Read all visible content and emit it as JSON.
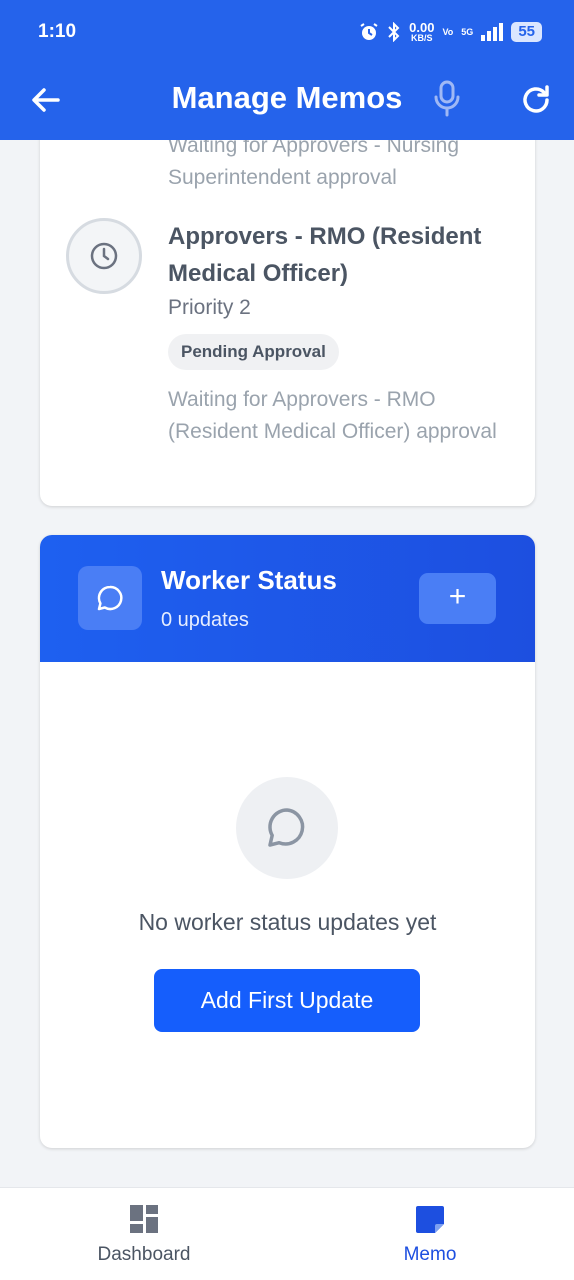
{
  "status_bar": {
    "time": "1:10",
    "net_speed_value": "0.00",
    "net_speed_unit": "KB/S",
    "volte": "Vo",
    "network": "5G",
    "battery": "55"
  },
  "app_bar": {
    "title": "Manage Memos",
    "back_icon": "arrow-left-icon",
    "mic_icon": "microphone-icon",
    "refresh_icon": "refresh-icon"
  },
  "approver_card": {
    "previous_waiting_text": "Waiting for Approvers - Nursing Superintendent approval",
    "approver_title": "Approvers - RMO (Resident Medical Officer)",
    "priority": "Priority 2",
    "status_pill": "Pending Approval",
    "waiting_text": "Waiting for Approvers - RMO (Resident Medical Officer) approval",
    "icon": "clock-icon"
  },
  "worker_status": {
    "title": "Worker Status",
    "count": "0 updates",
    "add_label": "+",
    "empty_text": "No worker status updates yet",
    "add_first_label": "Add First Update",
    "icon": "chat-bubble-icon"
  },
  "bottom_nav": {
    "items": [
      {
        "label": "Dashboard",
        "icon": "dashboard-grid-icon",
        "active": false
      },
      {
        "label": "Memo",
        "icon": "memo-note-icon",
        "active": true
      }
    ]
  },
  "colors": {
    "primary": "#2563eb",
    "header_gradient": "#1e60f0",
    "button": "#155efc",
    "background": "#f2f4f7"
  }
}
